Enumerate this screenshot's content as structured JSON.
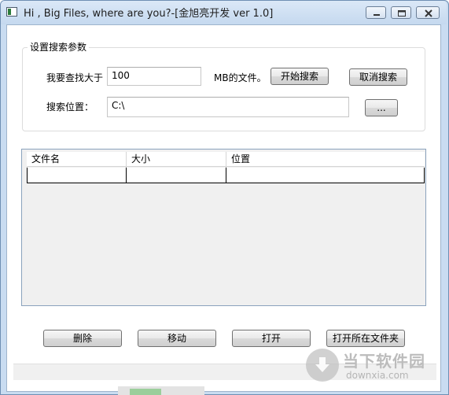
{
  "window": {
    "title": "Hi , Big Files, where are you?-[金旭亮开发 ver 1.0]"
  },
  "search_params": {
    "group_title": "设置搜索参数",
    "size_label": "我要查找大于",
    "size_value": "100",
    "size_unit": "MB的文件。",
    "start_button": "开始搜索",
    "cancel_button": "取消搜索",
    "location_label": "搜索位置：",
    "location_value": "C:\\",
    "browse_button": "..."
  },
  "results": {
    "columns": [
      "文件名",
      "大小",
      "位置"
    ]
  },
  "actions": {
    "delete": "删除",
    "move": "移动",
    "open": "打开",
    "open_folder": "打开所在文件夹"
  },
  "watermark": {
    "brand": "当下软件园",
    "domain": "downxia.com"
  },
  "colors": {
    "titlebar": "#c5d9ef",
    "frame": "#6f8fb3",
    "list_border": "#8aa2bd"
  }
}
